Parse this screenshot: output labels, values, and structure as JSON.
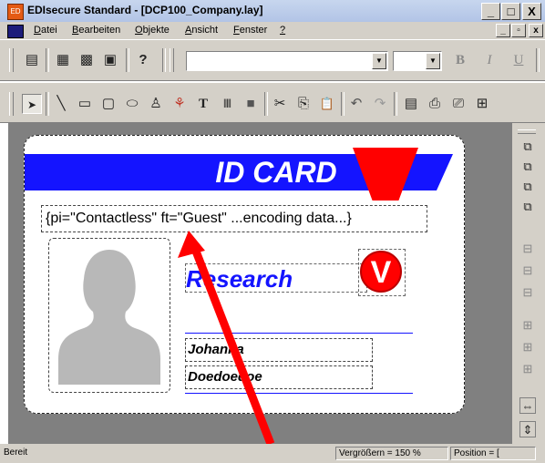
{
  "window": {
    "title": "EDIsecure Standard - [DCP100_Company.lay]",
    "app_icon_glyph": "ED",
    "minimize_label": "_",
    "maximize_label": "□",
    "close_label": "X"
  },
  "menu": {
    "items": [
      {
        "accel": "D",
        "rest": "atei"
      },
      {
        "accel": "B",
        "rest": "earbeiten"
      },
      {
        "accel": "O",
        "rest": "bjekte"
      },
      {
        "accel": "A",
        "rest": "nsicht"
      },
      {
        "accel": "F",
        "rest": "enster"
      },
      {
        "accel": "?",
        "rest": ""
      }
    ],
    "mdi_minimize": "_",
    "mdi_restore": "▫",
    "mdi_close": "x"
  },
  "toolbar1": {
    "icons": [
      "form-icon",
      "new-folder-icon",
      "open-database-icon",
      "save-database-icon",
      "help-icon"
    ],
    "glyphs": [
      "▤",
      "▦",
      "▩",
      "▣",
      "?"
    ],
    "font_combo_value": "",
    "size_combo_value": "",
    "bold_label": "B",
    "italic_label": "I",
    "underline_label": "U"
  },
  "toolbar2": {
    "glyphs": [
      "➤",
      "╲",
      "▭",
      "▢",
      "⬭",
      "♙",
      "⚘",
      "T",
      "|||||",
      "■",
      "✂",
      "⎘",
      "📋",
      "↶",
      "↷",
      "▤",
      "⎙",
      "⎚",
      "⊞"
    ],
    "names": [
      "select-tool-icon",
      "line-tool-icon",
      "rectangle-tool-icon",
      "rounded-rectangle-tool-icon",
      "ellipse-tool-icon",
      "image-tool-icon",
      "picture-tool-icon",
      "text-tool-icon",
      "barcode-tool-icon",
      "solid-fill-tool-icon",
      "cut-icon",
      "copy-icon",
      "paste-icon",
      "undo-icon",
      "redo-icon",
      "properties-icon",
      "print-icon",
      "print-preview-icon",
      "grid-icon"
    ]
  },
  "right_toolbar": {
    "glyphs": [
      "⧉",
      "⧉",
      "⧉",
      "⧉",
      "⊟",
      "⊟",
      "⊟",
      "⊞",
      "⊞",
      "⊞",
      "⇔",
      "⇕"
    ],
    "names": [
      "bring-to-front-icon",
      "send-to-back-icon",
      "bring-forward-icon",
      "send-backward-icon",
      "align-left-icon",
      "align-center-icon",
      "align-right-icon",
      "align-top-icon",
      "align-middle-icon",
      "align-bottom-icon",
      "same-width-icon",
      "same-height-icon"
    ]
  },
  "card": {
    "header_text": "ID CARD",
    "encoding_text": "{pi=\"Contactless\" ft=\"Guest\" ...encoding data...}",
    "department": "Research",
    "logo_letter": "V",
    "first_name": "Johanna",
    "last_name": "Doedoedoe"
  },
  "colors": {
    "card_blue": "#1414ff",
    "card_red": "#ff0000",
    "workspace_gray": "#808080",
    "chrome_gray": "#d4d0c8"
  },
  "statusbar": {
    "ready": "Bereit",
    "zoom": "Vergrößern = 150 %",
    "position": "Position = ["
  }
}
